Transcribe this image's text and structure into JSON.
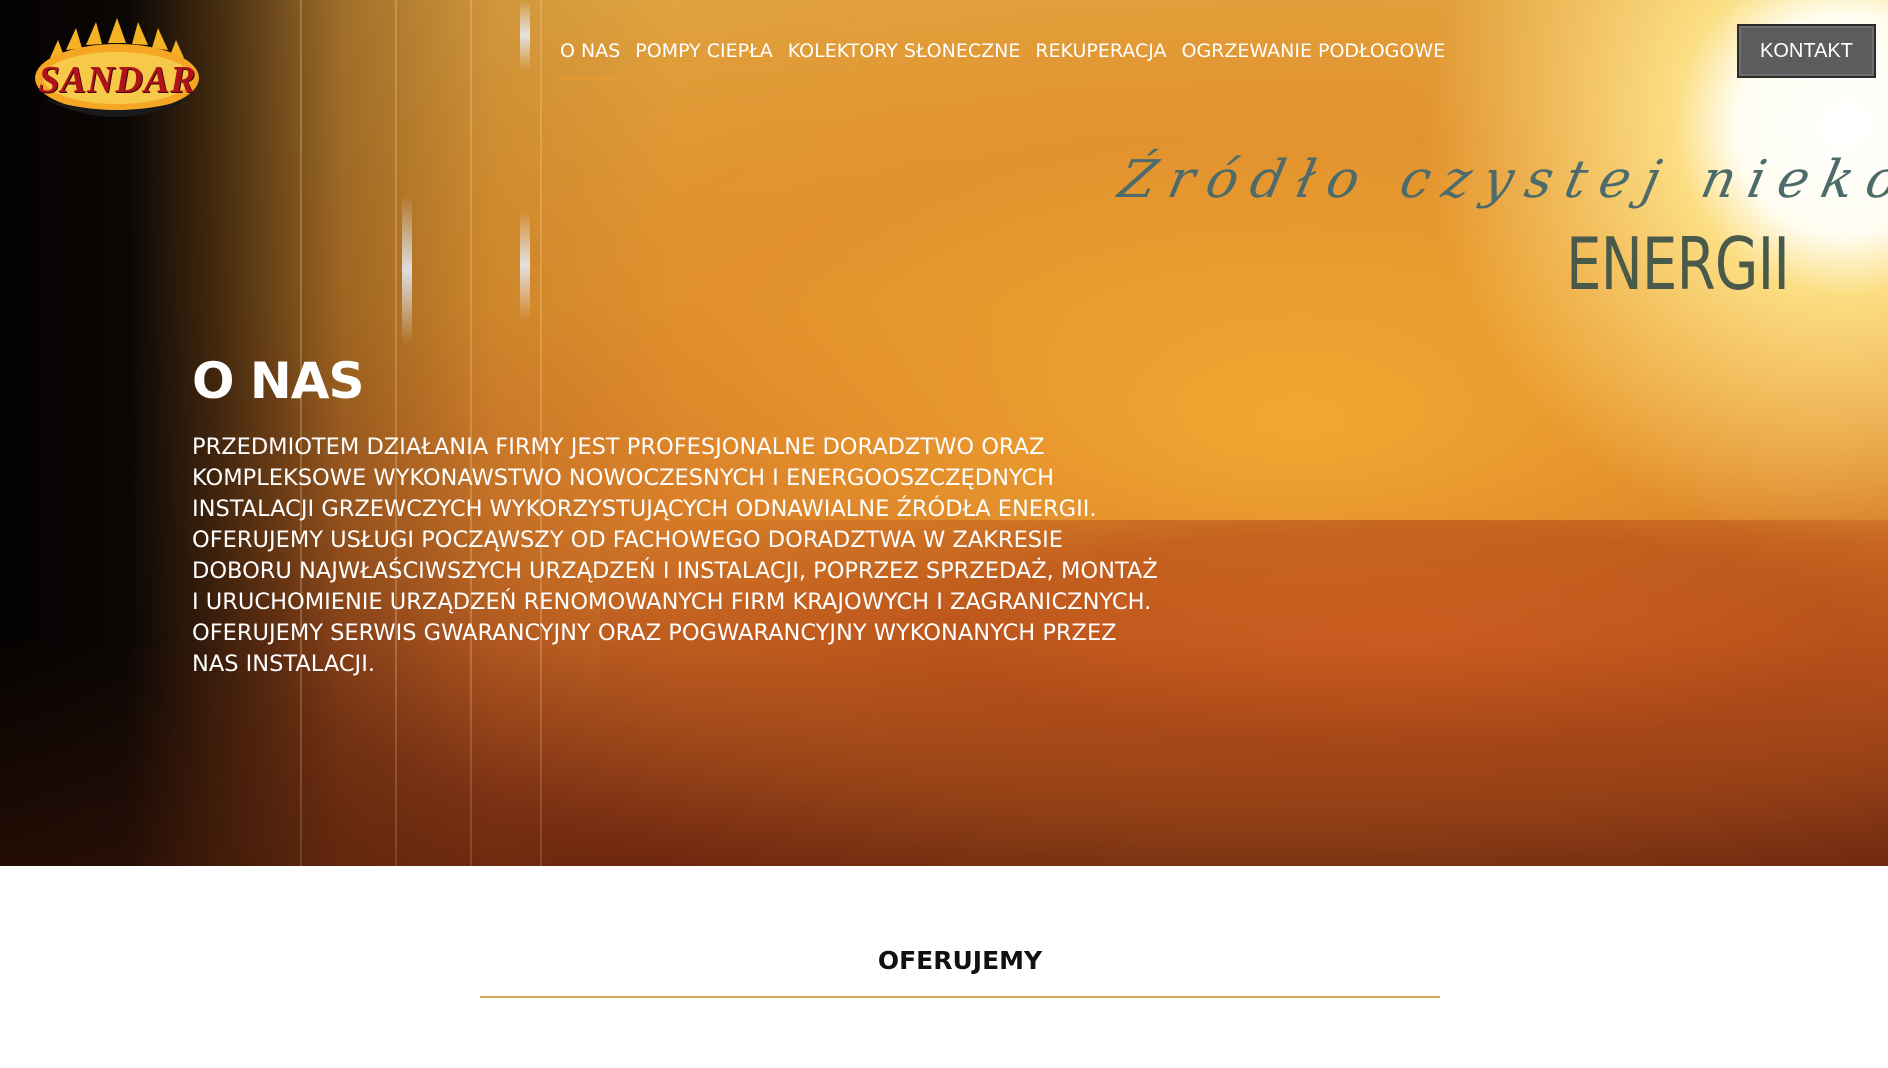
{
  "brand": {
    "logo_text": "SANDAR"
  },
  "nav": {
    "items": [
      {
        "label": "O NAS",
        "active": true
      },
      {
        "label": "POMPY CIEPŁA",
        "active": false
      },
      {
        "label": "KOLEKTORY SŁONECZNE",
        "active": false
      },
      {
        "label": "REKUPERACJA",
        "active": false
      },
      {
        "label": "OGRZEWANIE PODŁOGOWE",
        "active": false
      }
    ],
    "contact_label": "KONTAKT"
  },
  "hero": {
    "tagline": "Źródło czystej niekończącej się",
    "energy_word": "ENERGII"
  },
  "about": {
    "title": "O NAS",
    "paragraphs": [
      "PRZEDMIOTEM DZIAŁANIA FIRMY JEST PROFESJONALNE DORADZTWO ORAZ KOMPLEKSOWE WYKONAWSTWO NOWOCZESNYCH I ENERGOOSZCZĘDNYCH INSTALACJI GRZEWCZYCH WYKORZYSTUJĄCYCH ODNAWIALNE ŹRÓDŁA ENERGII.",
      "OFERUJEMY USŁUGI POCZĄWSZY OD FACHOWEGO DORADZTWA W ZAKRESIE DOBORU NAJWŁAŚCIWSZYCH URZĄDZEŃ I INSTALACJI, POPRZEZ SPRZEDAŻ, MONTAŻ I URUCHOMIENIE URZĄDZEŃ RENOMOWANYCH FIRM KRAJOWYCH I ZAGRANICZNYCH.",
      "OFERUJEMY SERWIS GWARANCYJNY ORAZ POGWARANCYJNY WYKONANYCH PRZEZ NAS INSTALACJI."
    ]
  },
  "offer": {
    "heading": "OFERUJEMY"
  },
  "colors": {
    "accent": "#e49a34",
    "contact_button_bg": "#5c5c5c",
    "rule": "#d5a661",
    "logo_red": "#b0141a"
  }
}
